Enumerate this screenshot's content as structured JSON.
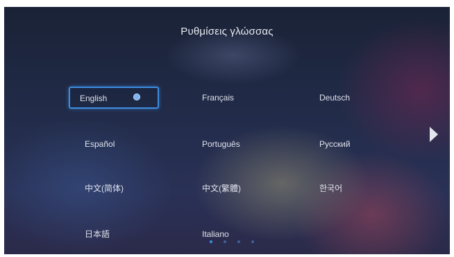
{
  "header": {
    "title": "Ρυθμίσεις γλώσσας"
  },
  "languages": [
    {
      "label": "English",
      "selected": true
    },
    {
      "label": "Français",
      "selected": false
    },
    {
      "label": "Deutsch",
      "selected": false
    },
    {
      "label": "Español",
      "selected": false
    },
    {
      "label": "Português",
      "selected": false
    },
    {
      "label": "Русский",
      "selected": false
    },
    {
      "label": "中文(简体)",
      "selected": false
    },
    {
      "label": "中文(繁體)",
      "selected": false
    },
    {
      "label": "한국어",
      "selected": false
    },
    {
      "label": "日本語",
      "selected": false
    },
    {
      "label": "Italiano",
      "selected": false
    }
  ],
  "navigation": {
    "next_icon": "chevron-right-icon",
    "page_count": 4,
    "current_page": 1
  },
  "colors": {
    "accent": "#3d8ee0",
    "text": "#dfe3ec"
  }
}
